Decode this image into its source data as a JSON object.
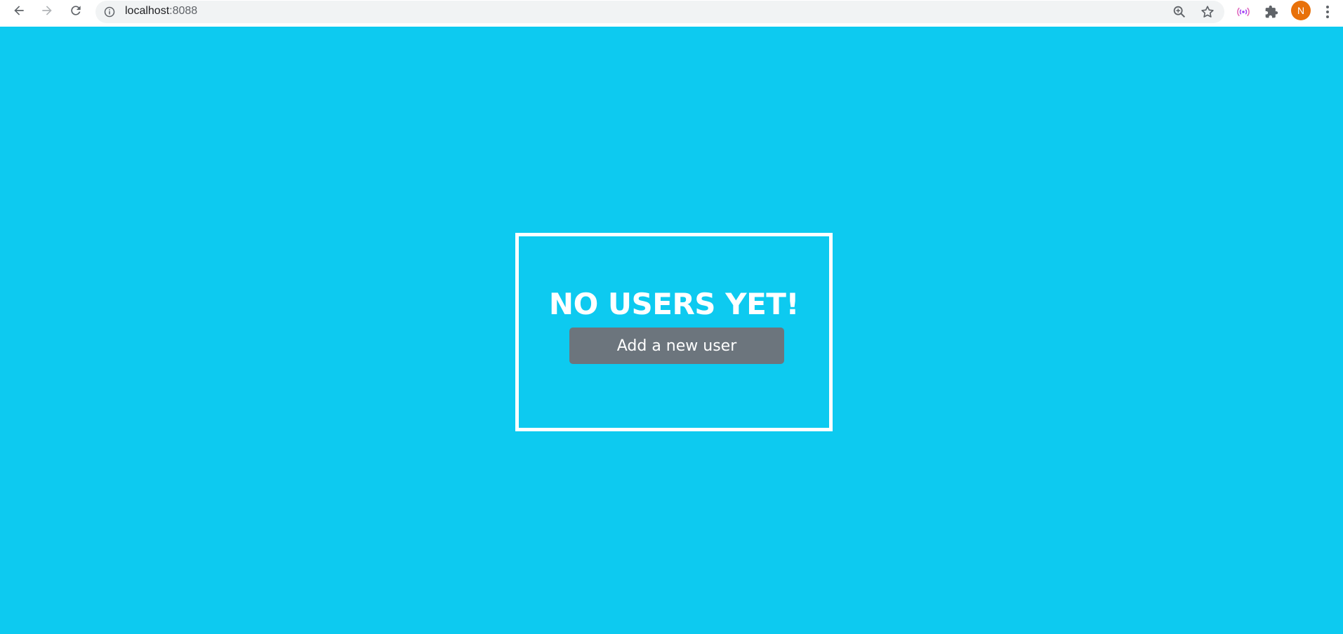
{
  "browser": {
    "url_host": "localhost",
    "url_port": ":8088",
    "avatar_initial": "N",
    "icons": [
      "back-arrow-icon",
      "forward-arrow-icon",
      "reload-icon",
      "info-icon",
      "zoom-icon",
      "star-icon",
      "cast-icon",
      "extensions-icon",
      "more-menu-icon"
    ]
  },
  "main": {
    "title": "NO USERS YET!",
    "add_button_label": "Add a new user",
    "background_color": "#0dcaf0",
    "button_color": "#6c757d"
  }
}
